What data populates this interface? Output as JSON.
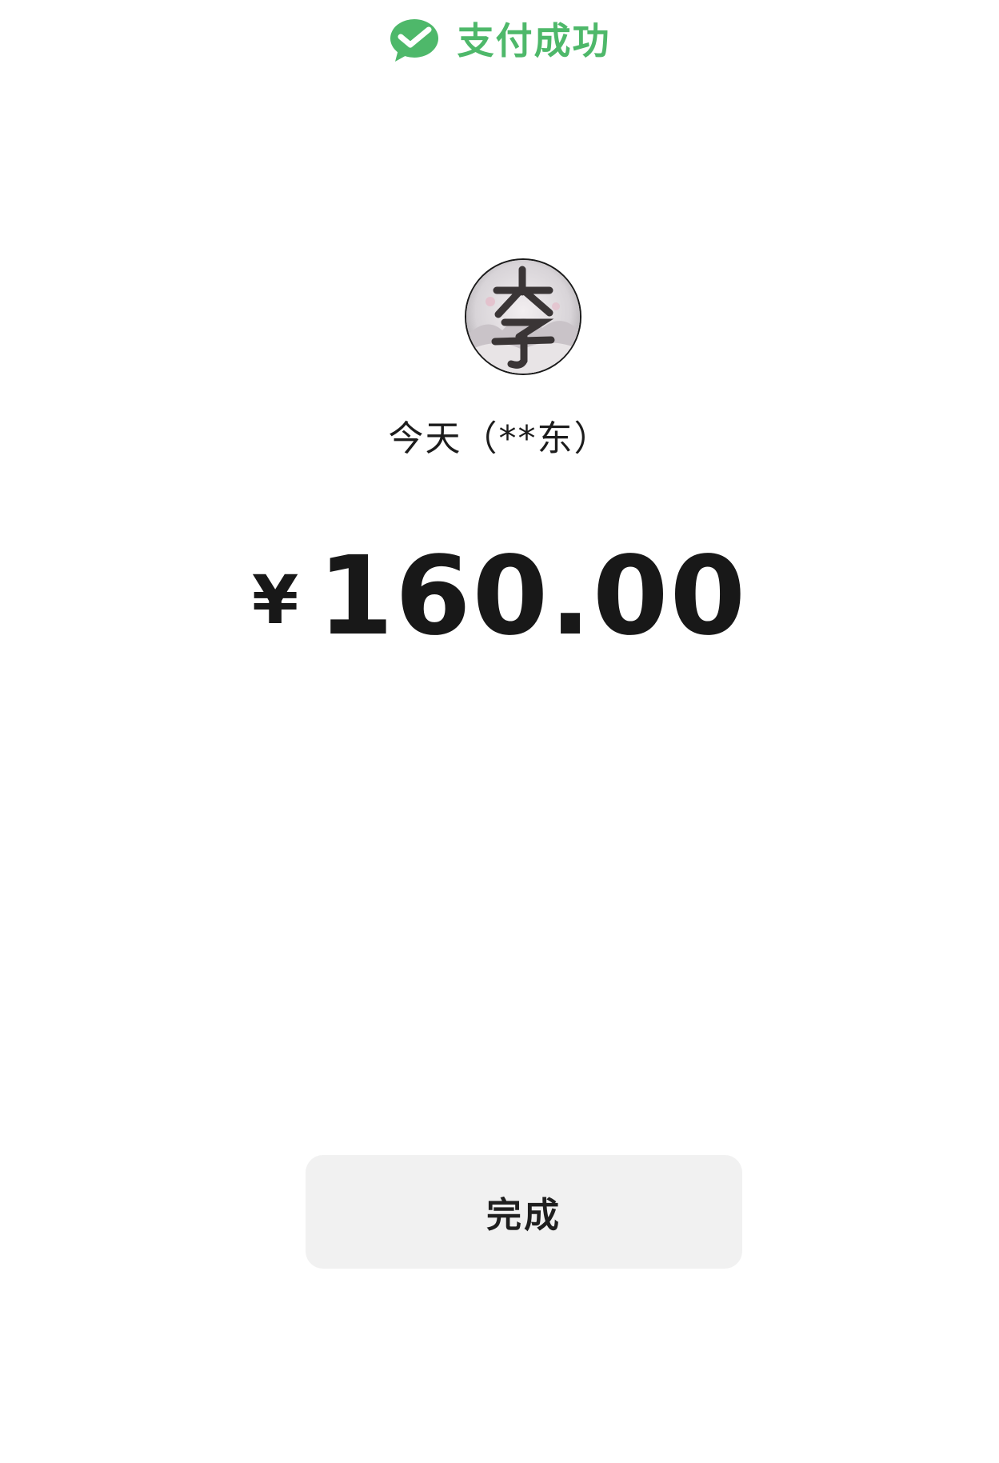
{
  "header": {
    "icon": "wechat-pay-icon",
    "title": "支付成功",
    "accent_color": "#4eb86a"
  },
  "payee": {
    "avatar_icon": "avatar-image",
    "name": "今天（**东）"
  },
  "payment": {
    "currency_symbol": "¥",
    "amount": "160.00"
  },
  "actions": {
    "done_label": "完成"
  }
}
